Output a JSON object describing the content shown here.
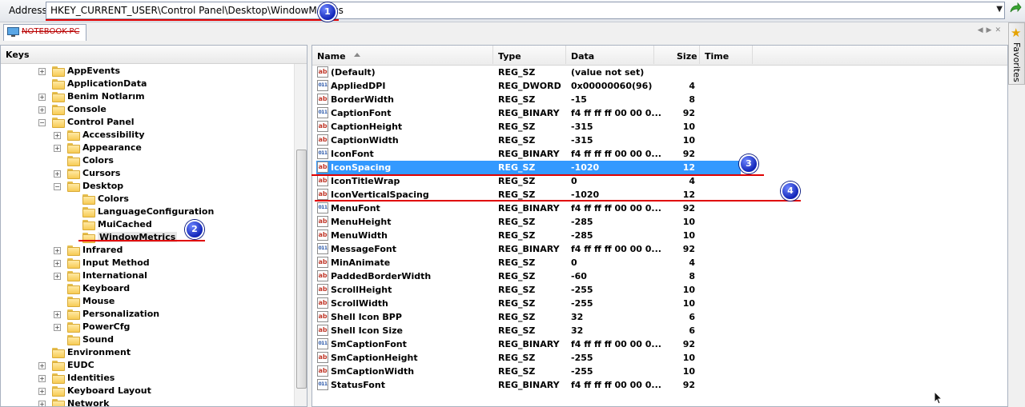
{
  "address": {
    "label": "Address",
    "value": "HKEY_CURRENT_USER\\Control Panel\\Desktop\\WindowMetrics"
  },
  "connection_tab": {
    "label": "NOTEBOOK-PC",
    "icon": "computer-icon"
  },
  "favorites": {
    "label": "Favorites",
    "icon": "star-icon"
  },
  "keys": {
    "title": "Keys",
    "items": [
      {
        "label": "AppEvents",
        "level": 1,
        "expander": "+"
      },
      {
        "label": "ApplicationData",
        "level": 1,
        "expander": ""
      },
      {
        "label": "Benim Notlarım",
        "level": 1,
        "expander": "+"
      },
      {
        "label": "Console",
        "level": 1,
        "expander": "+"
      },
      {
        "label": "Control Panel",
        "level": 1,
        "expander": "-"
      },
      {
        "label": "Accessibility",
        "level": 2,
        "expander": "+"
      },
      {
        "label": "Appearance",
        "level": 2,
        "expander": "+"
      },
      {
        "label": "Colors",
        "level": 2,
        "expander": ""
      },
      {
        "label": "Cursors",
        "level": 2,
        "expander": "+"
      },
      {
        "label": "Desktop",
        "level": 2,
        "expander": "-"
      },
      {
        "label": "Colors",
        "level": 3,
        "expander": ""
      },
      {
        "label": "LanguageConfiguration",
        "level": 3,
        "expander": ""
      },
      {
        "label": "MuiCached",
        "level": 3,
        "expander": ""
      },
      {
        "label": "WindowMetrics",
        "level": 3,
        "expander": "",
        "selected": true
      },
      {
        "label": "Infrared",
        "level": 2,
        "expander": "+"
      },
      {
        "label": "Input Method",
        "level": 2,
        "expander": "+"
      },
      {
        "label": "International",
        "level": 2,
        "expander": "+"
      },
      {
        "label": "Keyboard",
        "level": 2,
        "expander": ""
      },
      {
        "label": "Mouse",
        "level": 2,
        "expander": ""
      },
      {
        "label": "Personalization",
        "level": 2,
        "expander": "+"
      },
      {
        "label": "PowerCfg",
        "level": 2,
        "expander": "+"
      },
      {
        "label": "Sound",
        "level": 2,
        "expander": ""
      },
      {
        "label": "Environment",
        "level": 1,
        "expander": ""
      },
      {
        "label": "EUDC",
        "level": 1,
        "expander": "+"
      },
      {
        "label": "Identities",
        "level": 1,
        "expander": "+"
      },
      {
        "label": "Keyboard Layout",
        "level": 1,
        "expander": "+"
      },
      {
        "label": "Network",
        "level": 1,
        "expander": "+"
      }
    ]
  },
  "values": {
    "columns": [
      "Name",
      "Type",
      "Data",
      "Size",
      "Time"
    ],
    "rows": [
      {
        "name": "(Default)",
        "type": "REG_SZ",
        "data": "(value not set)",
        "size": "",
        "icon": "sz"
      },
      {
        "name": "AppliedDPI",
        "type": "REG_DWORD",
        "data": "0x00000060(96)",
        "size": "4",
        "icon": "bin"
      },
      {
        "name": "BorderWidth",
        "type": "REG_SZ",
        "data": "-15",
        "size": "8",
        "icon": "sz"
      },
      {
        "name": "CaptionFont",
        "type": "REG_BINARY",
        "data": "f4 ff ff ff 00 00 0...",
        "size": "92",
        "icon": "bin"
      },
      {
        "name": "CaptionHeight",
        "type": "REG_SZ",
        "data": "-315",
        "size": "10",
        "icon": "sz"
      },
      {
        "name": "CaptionWidth",
        "type": "REG_SZ",
        "data": "-315",
        "size": "10",
        "icon": "sz"
      },
      {
        "name": "IconFont",
        "type": "REG_BINARY",
        "data": "f4 ff ff ff 00 00 0...",
        "size": "92",
        "icon": "bin"
      },
      {
        "name": "IconSpacing",
        "type": "REG_SZ",
        "data": "-1020",
        "size": "12",
        "icon": "sz",
        "selected": true
      },
      {
        "name": "IconTitleWrap",
        "type": "REG_SZ",
        "data": "0",
        "size": "4",
        "icon": "sz"
      },
      {
        "name": "IconVerticalSpacing",
        "type": "REG_SZ",
        "data": "-1020",
        "size": "12",
        "icon": "sz"
      },
      {
        "name": "MenuFont",
        "type": "REG_BINARY",
        "data": "f4 ff ff ff 00 00 0...",
        "size": "92",
        "icon": "bin"
      },
      {
        "name": "MenuHeight",
        "type": "REG_SZ",
        "data": "-285",
        "size": "10",
        "icon": "sz"
      },
      {
        "name": "MenuWidth",
        "type": "REG_SZ",
        "data": "-285",
        "size": "10",
        "icon": "sz"
      },
      {
        "name": "MessageFont",
        "type": "REG_BINARY",
        "data": "f4 ff ff ff 00 00 0...",
        "size": "92",
        "icon": "bin"
      },
      {
        "name": "MinAnimate",
        "type": "REG_SZ",
        "data": "0",
        "size": "4",
        "icon": "sz"
      },
      {
        "name": "PaddedBorderWidth",
        "type": "REG_SZ",
        "data": "-60",
        "size": "8",
        "icon": "sz"
      },
      {
        "name": "ScrollHeight",
        "type": "REG_SZ",
        "data": "-255",
        "size": "10",
        "icon": "sz"
      },
      {
        "name": "ScrollWidth",
        "type": "REG_SZ",
        "data": "-255",
        "size": "10",
        "icon": "sz"
      },
      {
        "name": "Shell Icon BPP",
        "type": "REG_SZ",
        "data": "32",
        "size": "6",
        "icon": "sz"
      },
      {
        "name": "Shell Icon Size",
        "type": "REG_SZ",
        "data": "32",
        "size": "6",
        "icon": "sz"
      },
      {
        "name": "SmCaptionFont",
        "type": "REG_BINARY",
        "data": "f4 ff ff ff 00 00 0...",
        "size": "92",
        "icon": "bin"
      },
      {
        "name": "SmCaptionHeight",
        "type": "REG_SZ",
        "data": "-255",
        "size": "10",
        "icon": "sz"
      },
      {
        "name": "SmCaptionWidth",
        "type": "REG_SZ",
        "data": "-255",
        "size": "10",
        "icon": "sz"
      },
      {
        "name": "StatusFont",
        "type": "REG_BINARY",
        "data": "f4 ff ff ff 00 00 0...",
        "size": "92",
        "icon": "bin"
      }
    ]
  },
  "annotations": [
    "1",
    "2",
    "3",
    "4"
  ],
  "colors": {
    "selection": "#3399ff",
    "annotation_line": "#e00000",
    "annotation_marker": "#1a2fd0"
  }
}
